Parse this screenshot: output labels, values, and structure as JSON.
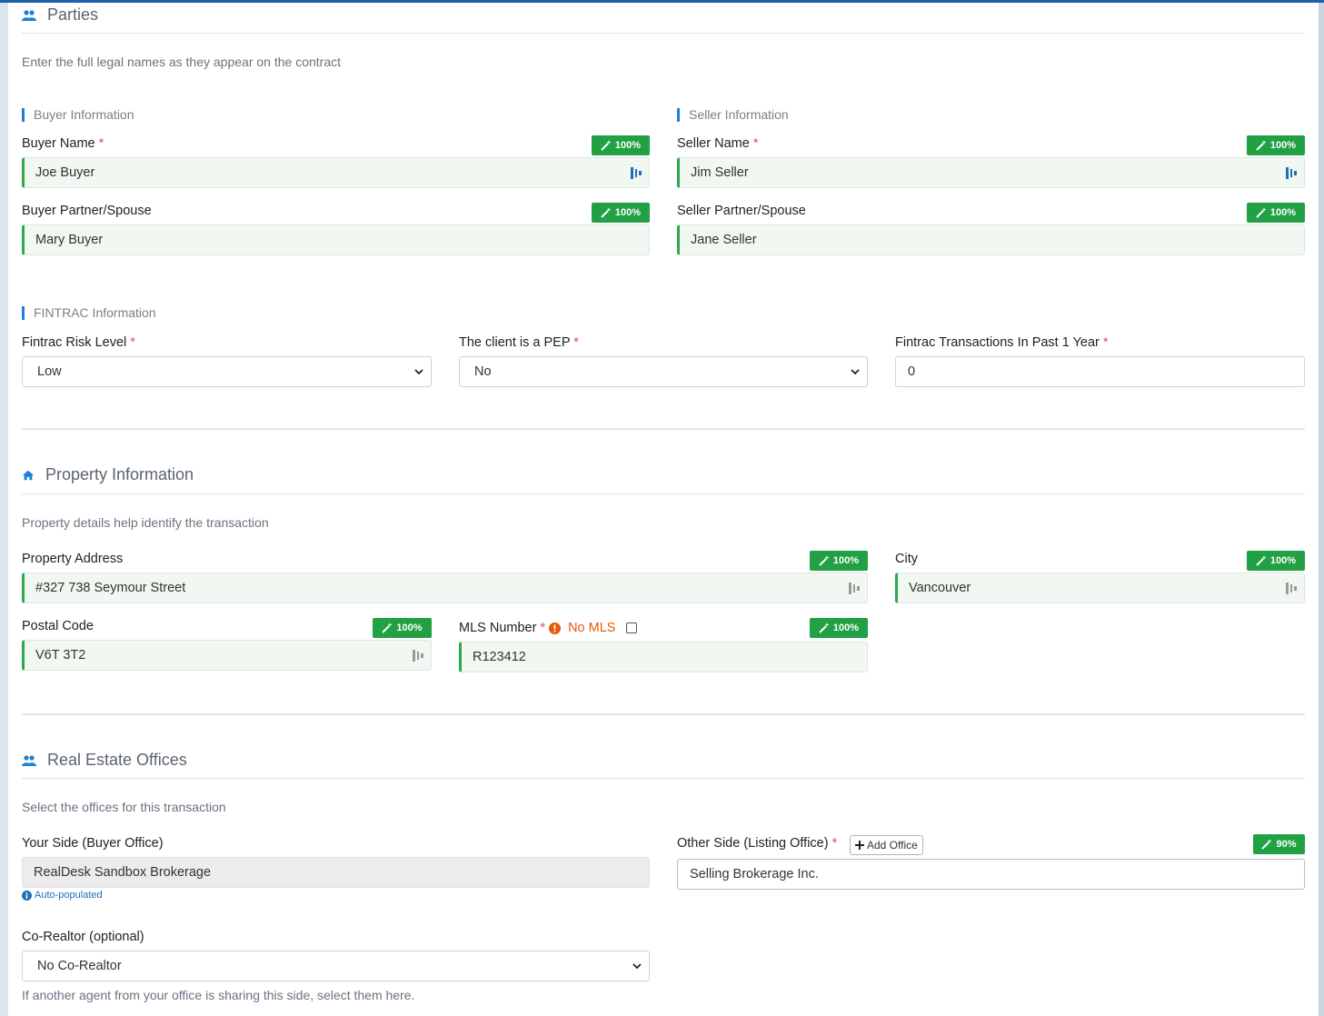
{
  "parties": {
    "title": "Parties",
    "description": "Enter the full legal names as they appear on the contract",
    "buyer_heading": "Buyer Information",
    "seller_heading": "Seller Information",
    "buyer_name_label": "Buyer Name",
    "buyer_name_value": "Joe Buyer",
    "buyer_partner_label": "Buyer Partner/Spouse",
    "buyer_partner_value": "Mary Buyer",
    "seller_name_label": "Seller Name",
    "seller_name_value": "Jim Seller",
    "seller_partner_label": "Seller Partner/Spouse",
    "seller_partner_value": "Jane Seller",
    "required_mark": "*",
    "confidence": "100%"
  },
  "fintrac": {
    "heading": "FINTRAC Information",
    "risk_label": "Fintrac Risk Level",
    "risk_value": "Low",
    "pep_label": "The client is a PEP",
    "pep_value": "No",
    "transactions_label": "Fintrac Transactions In Past 1 Year",
    "transactions_value": "0"
  },
  "property": {
    "title": "Property Information",
    "description": "Property details help identify the transaction",
    "address_label": "Property Address",
    "address_value": "#327 738 Seymour Street",
    "city_label": "City",
    "city_value": "Vancouver",
    "postal_label": "Postal Code",
    "postal_value": "V6T 3T2",
    "mls_label": "MLS Number",
    "no_mls_label": "No MLS",
    "mls_value": "R123412",
    "confidence": "100%"
  },
  "offices": {
    "title": "Real Estate Offices",
    "description": "Select the offices for this transaction",
    "your_side_label": "Your Side (Buyer Office)",
    "your_side_value": "RealDesk Sandbox Brokerage",
    "auto_populated": "Auto-populated",
    "other_side_label": "Other Side (Listing Office)",
    "add_office_label": "Add Office",
    "other_side_value": "Selling Brokerage Inc.",
    "other_side_confidence": "90%",
    "corealtor_label": "Co-Realtor (optional)",
    "corealtor_value": "No Co-Realtor",
    "corealtor_help": "If another agent from your office is sharing this side, select them here."
  },
  "colors": {
    "accent": "#1e7fd8",
    "confidence_badge": "#21a044",
    "required": "#d9534f",
    "warning": "#e8590c"
  }
}
